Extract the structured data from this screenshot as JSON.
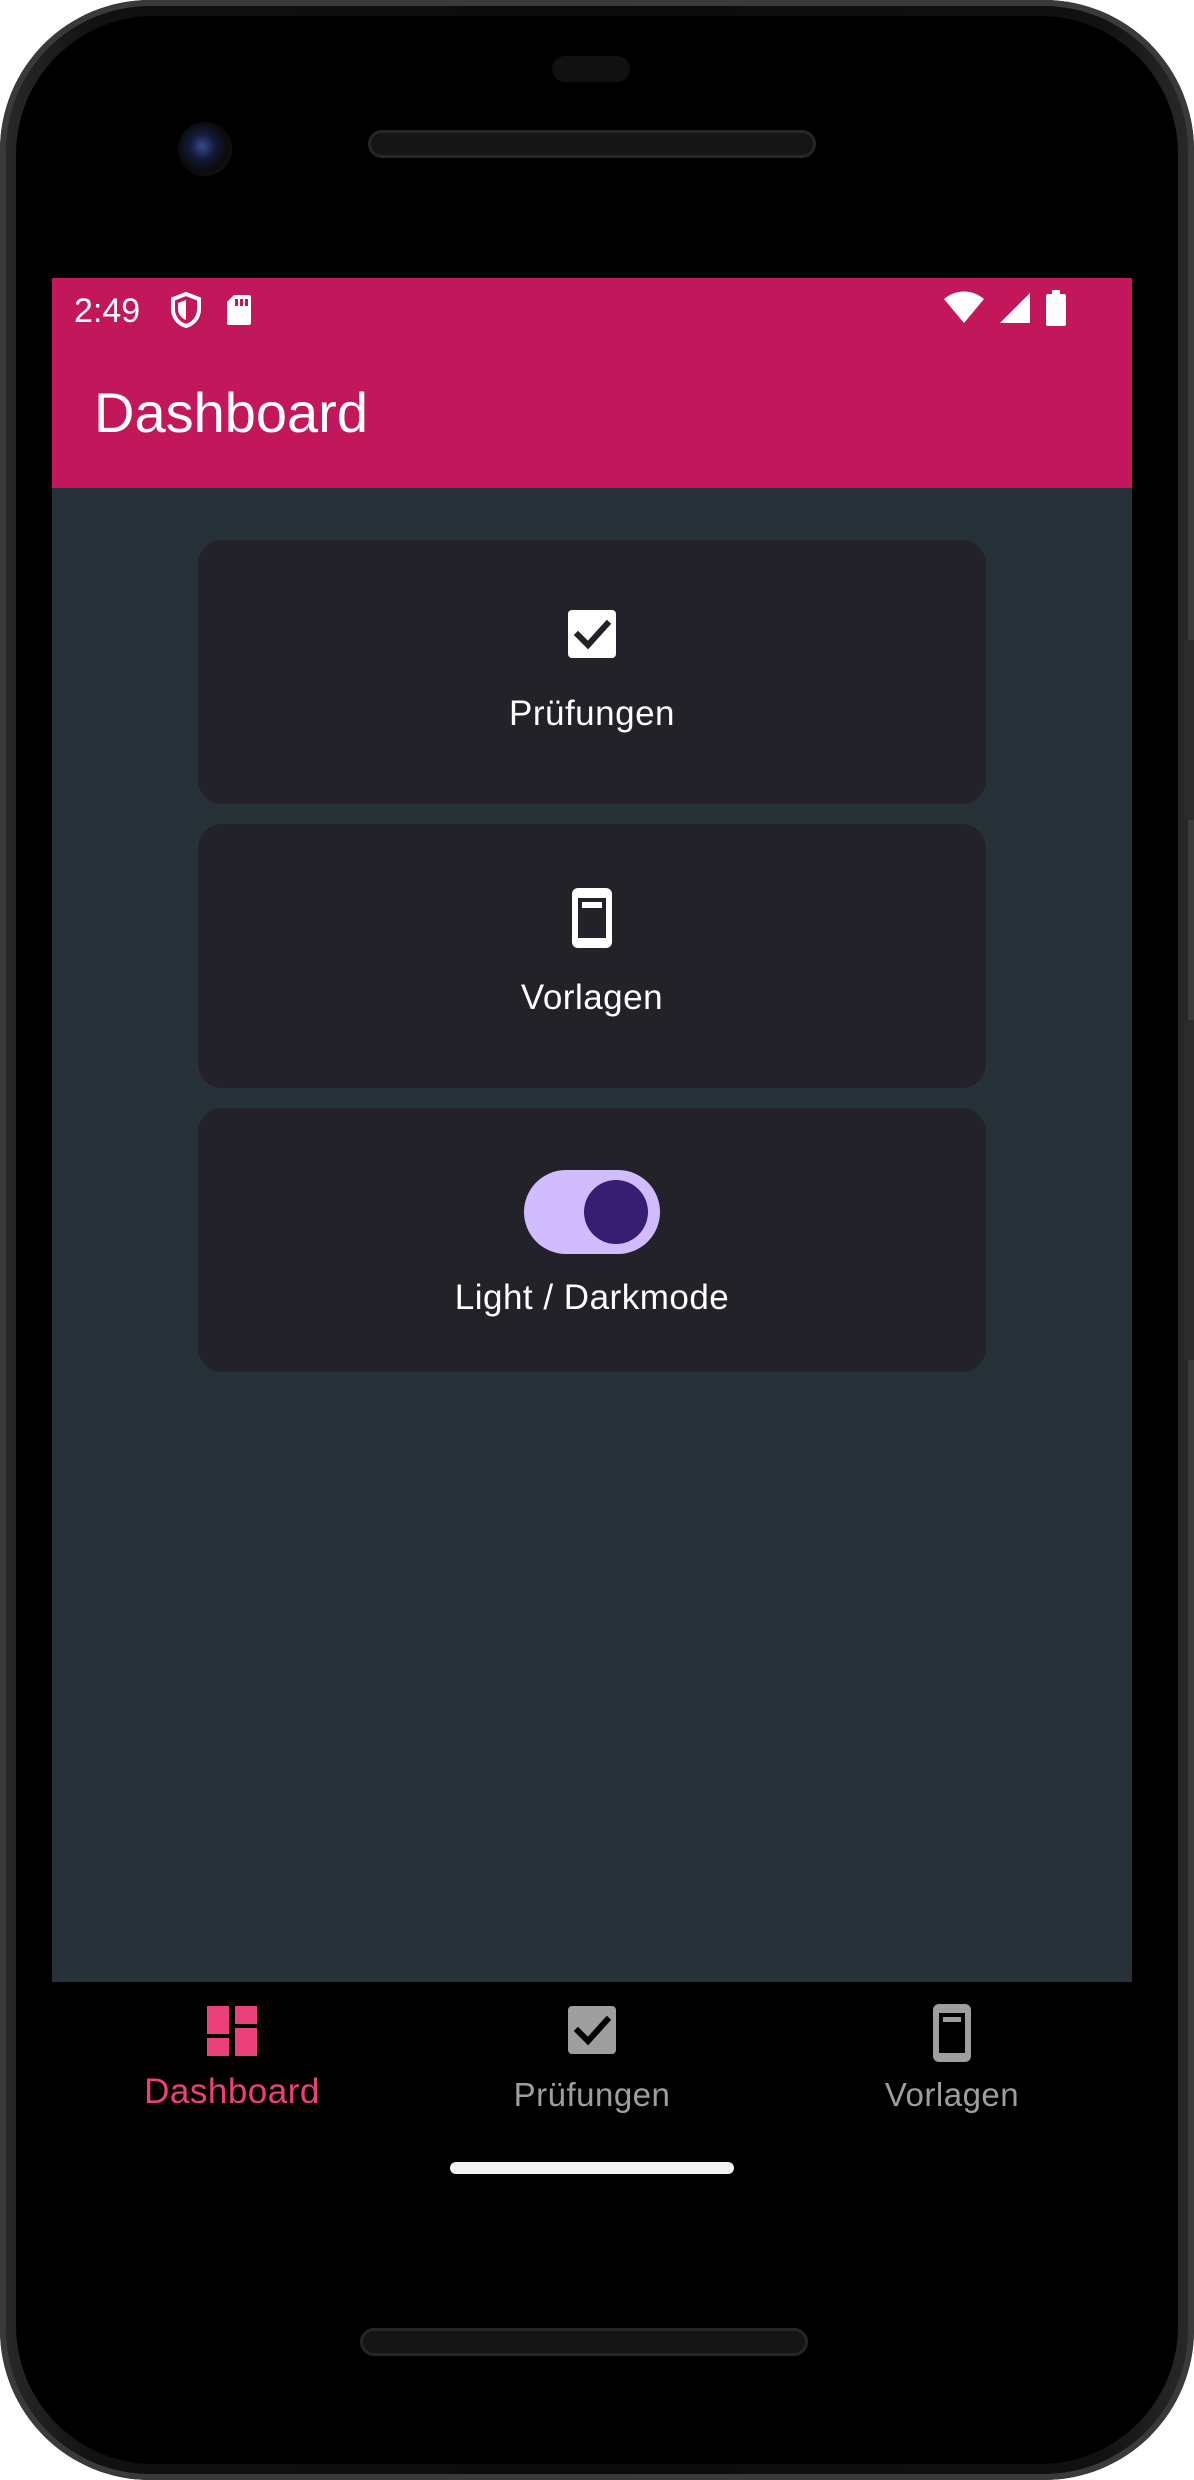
{
  "status_bar": {
    "time": "2:49",
    "icons": [
      "shield-icon",
      "sd-card-icon",
      "wifi-icon",
      "signal-icon",
      "battery-icon"
    ]
  },
  "app_bar": {
    "title": "Dashboard",
    "color": "#c2185b"
  },
  "cards": [
    {
      "label": "Prüfungen",
      "icon": "checkbox-icon"
    },
    {
      "label": "Vorlagen",
      "icon": "phone-icon"
    },
    {
      "label": "Light / Darkmode",
      "icon": "toggle-switch",
      "toggle_on": true
    }
  ],
  "bottom_nav": {
    "items": [
      {
        "label": "Dashboard",
        "icon": "dashboard-icon",
        "active": true
      },
      {
        "label": "Prüfungen",
        "icon": "checkbox-icon",
        "active": false
      },
      {
        "label": "Vorlagen",
        "icon": "phone-icon",
        "active": false
      }
    ],
    "active_color": "#ec407a",
    "inactive_color": "#9e9e9e"
  },
  "theme": {
    "background": "#263238",
    "card": "#232228",
    "toggle_track": "#d0bcff",
    "toggle_knob": "#381e72"
  }
}
